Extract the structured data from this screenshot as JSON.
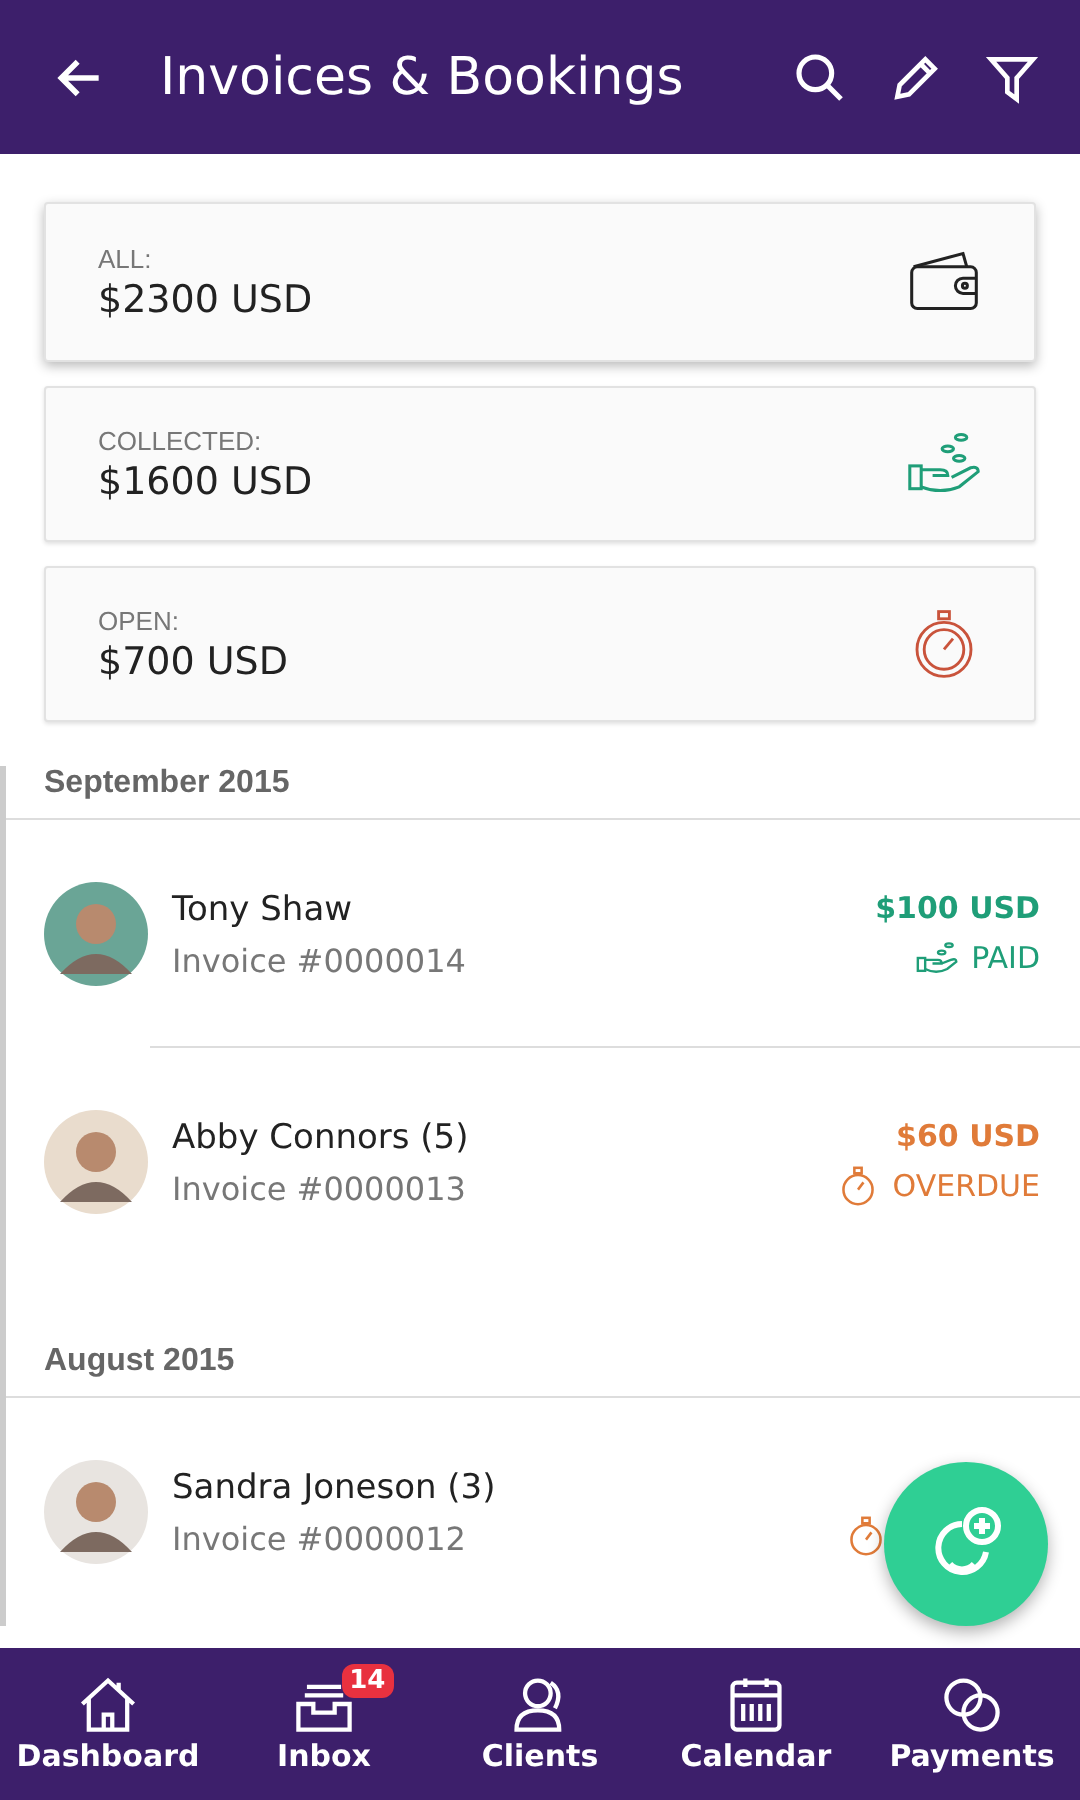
{
  "app_bar": {
    "title": "Invoices & Bookings"
  },
  "summary_cards": [
    {
      "kind": "all",
      "label": "ALL:",
      "amount": "$2300 USD",
      "raised": true
    },
    {
      "kind": "collected",
      "label": "COLLECTED:",
      "amount": "$1600 USD",
      "raised": false
    },
    {
      "kind": "open",
      "label": "OPEN:",
      "amount": "$700 USD",
      "raised": false
    }
  ],
  "sections": [
    {
      "title": "September 2015",
      "items": [
        {
          "name": "Tony Shaw",
          "invoice": "Invoice #0000014",
          "amount": "$100 USD",
          "status": "PAID",
          "kind": "paid"
        },
        {
          "name": "Abby Connors (5)",
          "invoice": "Invoice #0000013",
          "amount": "$60 USD",
          "status": "OVERDUE",
          "kind": "overdue"
        }
      ]
    },
    {
      "title": "August 2015",
      "items": [
        {
          "name": "Sandra Joneson (3)",
          "invoice": "Invoice #0000012",
          "kind": "overdue"
        }
      ]
    }
  ],
  "bottom_nav": [
    {
      "kind": "home",
      "label": "Dashboard"
    },
    {
      "kind": "inbox",
      "label": "Inbox",
      "badge": "14"
    },
    {
      "kind": "clients",
      "label": "Clients"
    },
    {
      "kind": "calendar",
      "label": "Calendar"
    },
    {
      "kind": "payments",
      "label": "Payments"
    }
  ]
}
